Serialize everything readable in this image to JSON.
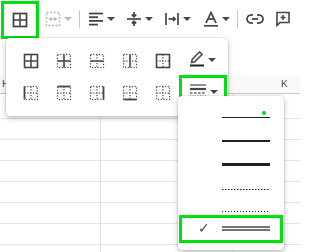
{
  "toolbar": {
    "items": [
      {
        "name": "borders-button",
        "icon": "borders-icon"
      },
      {
        "name": "merge-cells-button",
        "icon": "merge-cells-icon"
      },
      {
        "name": "horizontal-align-button",
        "icon": "align-left-icon"
      },
      {
        "name": "vertical-align-button",
        "icon": "vertical-align-icon"
      },
      {
        "name": "text-wrapping-button",
        "icon": "text-wrap-icon"
      },
      {
        "name": "text-rotation-button",
        "icon": "text-rotation-icon"
      },
      {
        "name": "insert-link-button",
        "icon": "link-icon"
      },
      {
        "name": "insert-comment-button",
        "icon": "comment-icon"
      }
    ]
  },
  "grid": {
    "column_headers": [
      "H",
      "K"
    ]
  },
  "border_panel": {
    "border_types": [
      "all-borders-icon",
      "inner-borders-icon",
      "horizontal-borders-icon",
      "vertical-borders-icon",
      "outer-borders-icon",
      "left-border-icon",
      "top-border-icon",
      "right-border-icon",
      "bottom-border-icon",
      "clear-borders-icon"
    ],
    "border_color_icon": "pencil-icon",
    "border_style_icon": "border-style-icon"
  },
  "style_dropdown": {
    "options": [
      "thin-solid",
      "medium-solid",
      "thick-solid",
      "dotted",
      "dashed",
      "double"
    ],
    "selected_option": "double",
    "check_mark": "✓"
  },
  "colors": {
    "highlight": "#00e00e",
    "icon": "#444746"
  }
}
